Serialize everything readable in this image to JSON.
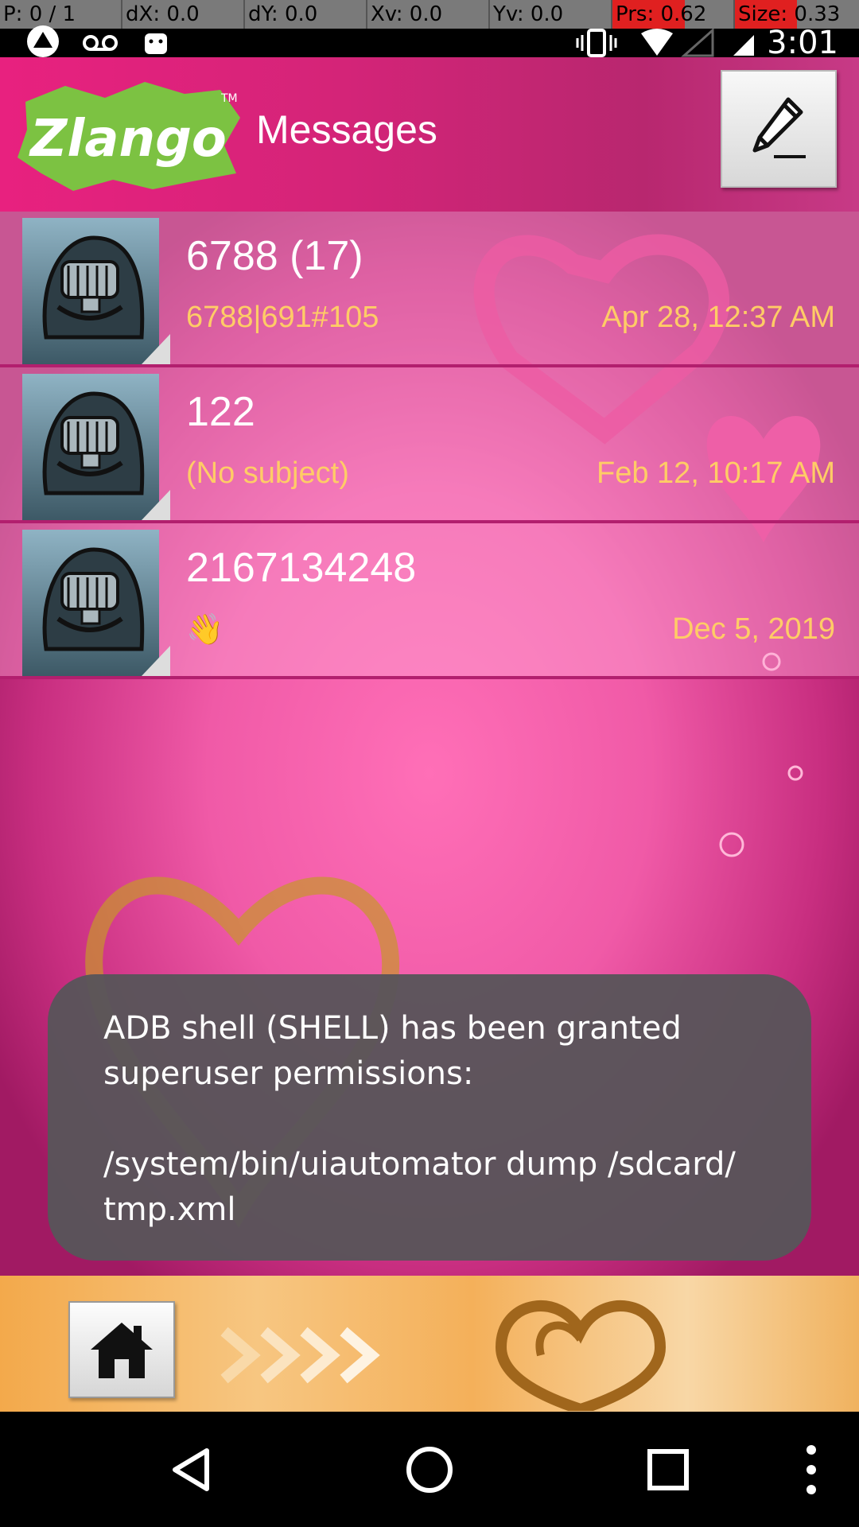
{
  "pointer_bar": {
    "p": "P: 0 / 1",
    "dx": "dX: 0.0",
    "dy": "dY: 0.0",
    "xv": "Xv: 0.0",
    "yv": "Yv: 0.0",
    "prs": "Prs: 0.62",
    "size": "Size: 0.33"
  },
  "status_bar": {
    "time": "3:01"
  },
  "header": {
    "logo_text": "Zlango",
    "title": "Messages"
  },
  "conversations": [
    {
      "title": "6788 (17)",
      "subtitle": "6788|691#105",
      "date": "Apr 28, 12:37 AM"
    },
    {
      "title": "122",
      "subtitle": "(No subject)",
      "date": "Feb 12, 10:17 AM"
    },
    {
      "title": "2167134248",
      "subtitle": "👋",
      "date": "Dec 5, 2019"
    }
  ],
  "toast": {
    "text": "ADB shell (SHELL) has been granted superuser permissions:\n\n/system/bin/uiautomator dump /sdcard/\ntmp.xml"
  },
  "colors": {
    "accent": "#e8217f",
    "date_text": "#ffcc66",
    "toast_bg": "#58545a"
  }
}
